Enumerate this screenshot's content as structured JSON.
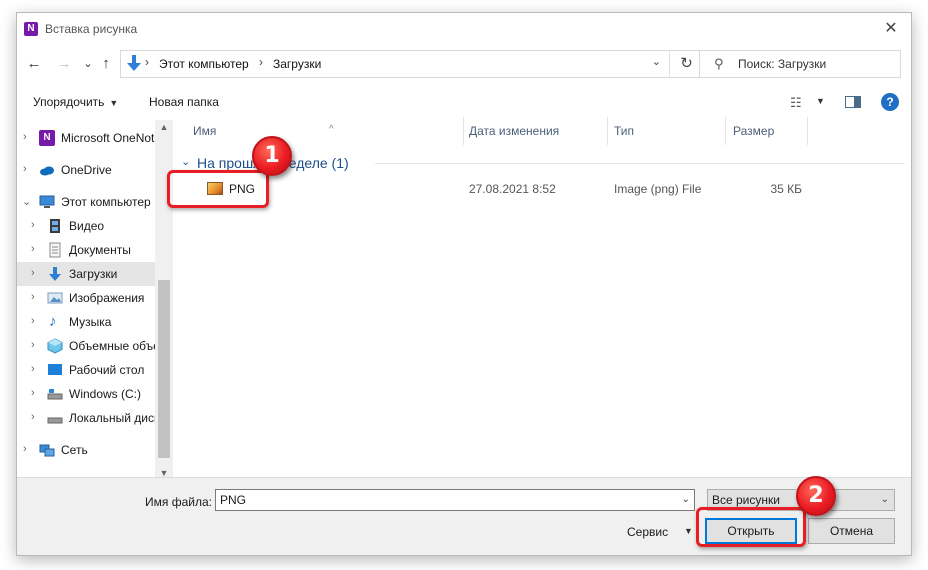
{
  "window": {
    "title": "Вставка рисунка",
    "close_glyph": "✕"
  },
  "navbar": {
    "back_glyph": "←",
    "forward_glyph": "→",
    "recent_glyph": "⌄",
    "up_glyph": "↑",
    "breadcrumb": [
      "Этот компьютер",
      "Загрузки"
    ],
    "refresh_glyph": "↻",
    "search_placeholder": "Поиск: Загрузки"
  },
  "toolbar": {
    "organize_label": "Упорядочить",
    "new_folder_label": "Новая папка",
    "help_glyph": "?"
  },
  "nav_tree": [
    {
      "label": "Microsoft OneNote",
      "icon": "onenote-icon",
      "level": 0,
      "selected": false
    },
    {
      "label": "OneDrive",
      "icon": "cloud-icon",
      "level": 0,
      "selected": false
    },
    {
      "label": "Этот компьютер",
      "icon": "computer-icon",
      "level": 0,
      "expanded": true,
      "selected": false
    },
    {
      "label": "Видео",
      "icon": "video-icon",
      "level": 1,
      "selected": false
    },
    {
      "label": "Документы",
      "icon": "documents-icon",
      "level": 1,
      "selected": false
    },
    {
      "label": "Загрузки",
      "icon": "downloads-icon",
      "level": 1,
      "selected": true
    },
    {
      "label": "Изображения",
      "icon": "pictures-icon",
      "level": 1,
      "selected": false
    },
    {
      "label": "Музыка",
      "icon": "music-icon",
      "level": 1,
      "selected": false
    },
    {
      "label": "Объемные объекты",
      "icon": "3d-objects-icon",
      "level": 1,
      "selected": false
    },
    {
      "label": "Рабочий стол",
      "icon": "desktop-icon",
      "level": 1,
      "selected": false
    },
    {
      "label": "Windows (C:)",
      "icon": "drive-icon",
      "level": 1,
      "selected": false
    },
    {
      "label": "Локальный диск",
      "icon": "drive-icon",
      "level": 1,
      "selected": false
    },
    {
      "label": "Сеть",
      "icon": "network-icon",
      "level": 0,
      "selected": false
    }
  ],
  "columns": [
    "Имя",
    "Дата изменения",
    "Тип",
    "Размер"
  ],
  "group": {
    "label": "На прошлой неделе (1)"
  },
  "files": [
    {
      "name": "PNG",
      "date": "27.08.2021 8:52",
      "type": "Image (png) File",
      "size": "35 КБ"
    }
  ],
  "bottom": {
    "filename_label": "Имя файла:",
    "filename_value": "PNG",
    "filter_value": "Все рисунки",
    "tools_label": "Сервис",
    "open_label": "Открыть",
    "cancel_label": "Отмена"
  },
  "annotations": {
    "step1": "1",
    "step2": "2",
    "accent_color": "#e81e25"
  }
}
